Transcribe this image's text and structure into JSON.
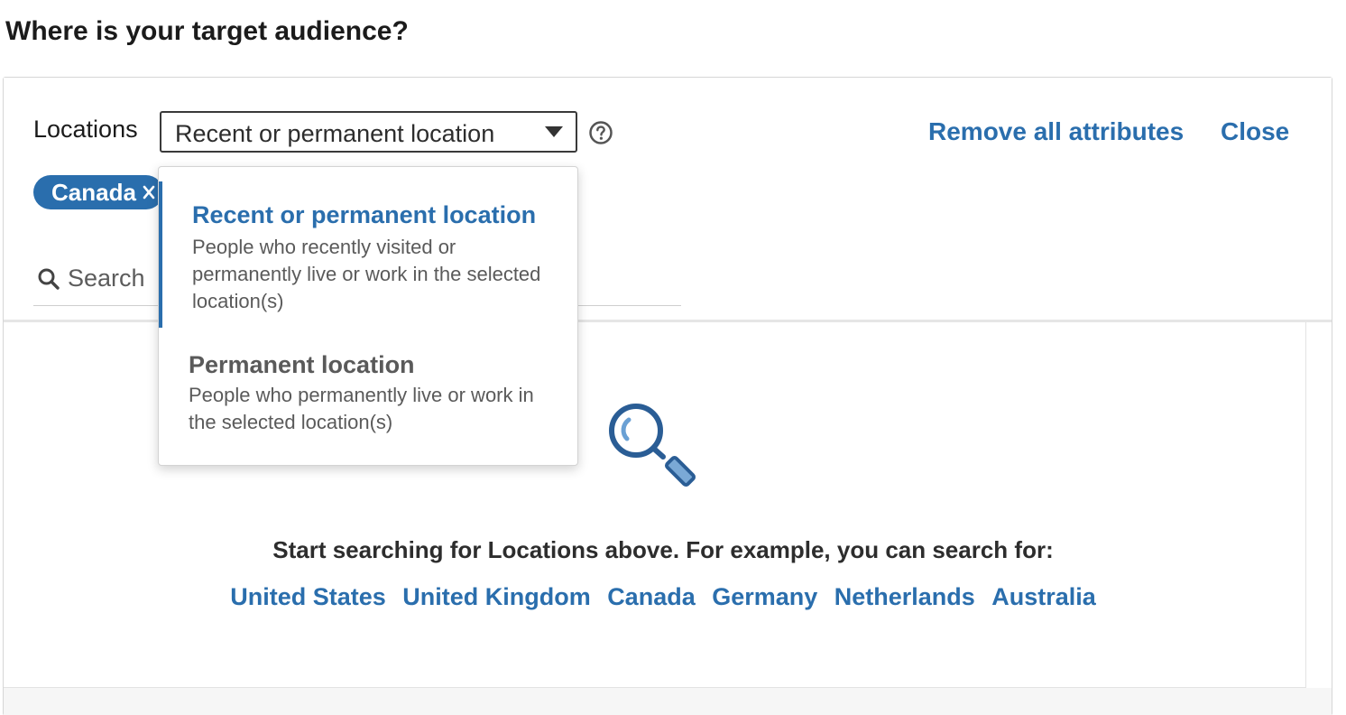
{
  "question": "Where is your target audience?",
  "header": {
    "locations_label": "Locations",
    "select_value": "Recent or permanent location",
    "help_icon": "question-circle-icon",
    "remove_all_label": "Remove all attributes",
    "close_label": "Close"
  },
  "selected_chips": [
    {
      "label": "Canada",
      "remove_icon": "close-icon"
    }
  ],
  "search": {
    "placeholder": "Search",
    "value": "",
    "icon": "search-icon"
  },
  "dropdown": {
    "options": [
      {
        "title": "Recent or permanent location",
        "description": "People who recently visited or permanently live or work in the selected location(s)",
        "selected": true
      },
      {
        "title": "Permanent location",
        "description": "People who permanently live or work in the selected location(s)",
        "selected": false
      }
    ]
  },
  "empty_state": {
    "illustration": "magnifying-glass-icon",
    "hint": "Start searching for Locations above. For example, you can search for:",
    "suggestions": [
      "United States",
      "United Kingdom",
      "Canada",
      "Germany",
      "Netherlands",
      "Australia"
    ]
  },
  "colors": {
    "accent": "#2a6ead",
    "chip_background": "#2a6ead",
    "text_primary": "#1b1b1b",
    "text_secondary": "#5a5a5a",
    "border": "#d6d6d6"
  }
}
